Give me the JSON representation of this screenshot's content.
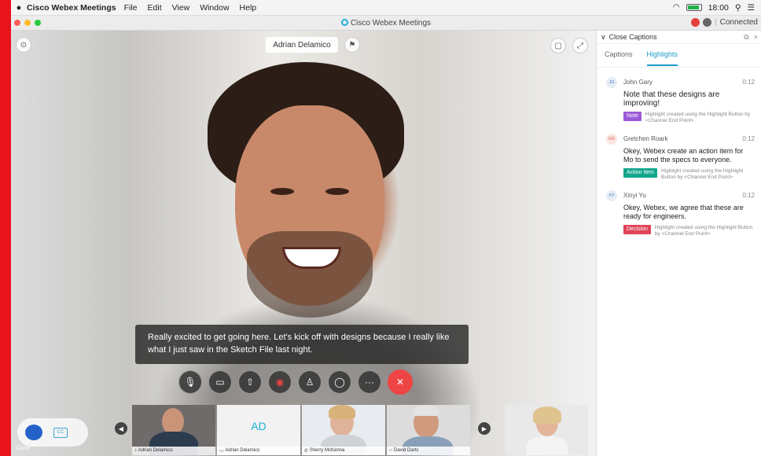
{
  "menubar": {
    "app": "Cisco Webex Meetings",
    "items": [
      "File",
      "Edit",
      "View",
      "Window",
      "Help"
    ],
    "clock": "18:00"
  },
  "window": {
    "title": "Cisco Webex Meetings",
    "status": "Connected"
  },
  "video": {
    "speaker_name": "Adrian Delamico",
    "caption": "Really excited to get going here. Let's kick off with designs because I really like what I just saw in the Sketch File last night."
  },
  "thumbnails": [
    {
      "name": "Adrian Delamico"
    },
    {
      "name": "Adrian Delamico",
      "initials": "AD"
    },
    {
      "name": "Sherry McKenna"
    },
    {
      "name": "David Darts"
    }
  ],
  "bottom_left": {
    "label": "Close"
  },
  "panel": {
    "title": "Close Captions",
    "tabs": [
      "Captions",
      "Highlights"
    ],
    "entries": [
      {
        "initials": "JG",
        "name": "John Gary",
        "time": "0:12",
        "text": "Note that these designs are improving!",
        "tag": "Note",
        "tag_color": "#9b59d6",
        "desc": "Highlight created using the Highlight Button by <Channel End Point>"
      },
      {
        "initials": "GR",
        "name": "Gretchen Roark",
        "time": "0:12",
        "text": "Okey, Webex create an action item for Mo to send the specs to everyone.",
        "tag": "Action Item",
        "tag_color": "#13a58c",
        "desc": "Highlight created using the Highlight Button by <Channel End Point>"
      },
      {
        "initials": "XY",
        "name": "Xinyi Yu",
        "time": "0:12",
        "text": "Okey, Webex, we agree that these are ready for engineers.",
        "tag": "Decision",
        "tag_color": "#e0445a",
        "desc": "Highlight created using the Highlight Button by <Channel End Point>"
      }
    ]
  }
}
